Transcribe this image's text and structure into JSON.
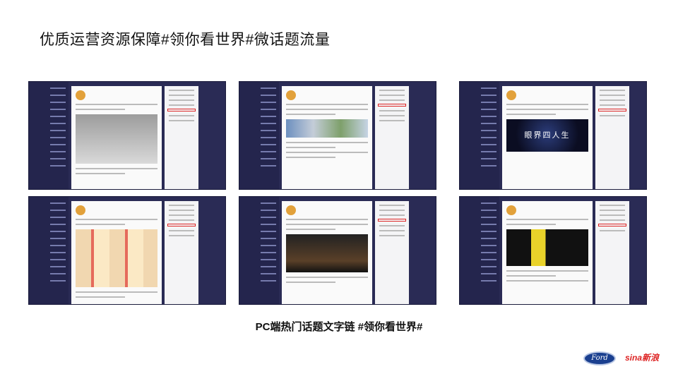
{
  "title": "优质运营资源保障#领你看世界#微话题流量",
  "caption": "PC端热门话题文字链 #领你看世界#",
  "screenshots": [
    {
      "id": "s1",
      "label": "screenshot-1"
    },
    {
      "id": "s2",
      "label": "screenshot-2"
    },
    {
      "id": "s3",
      "label": "screenshot-3",
      "video_text": "眼界四人生"
    },
    {
      "id": "s4",
      "label": "screenshot-4"
    },
    {
      "id": "s5",
      "label": "screenshot-5"
    },
    {
      "id": "s6",
      "label": "screenshot-6"
    }
  ],
  "logos": {
    "ford": "Ford",
    "sina": "sina新浪"
  },
  "colors": {
    "background": "#ffffff",
    "frame": "#2a2b55",
    "highlight": "#dd2222"
  }
}
